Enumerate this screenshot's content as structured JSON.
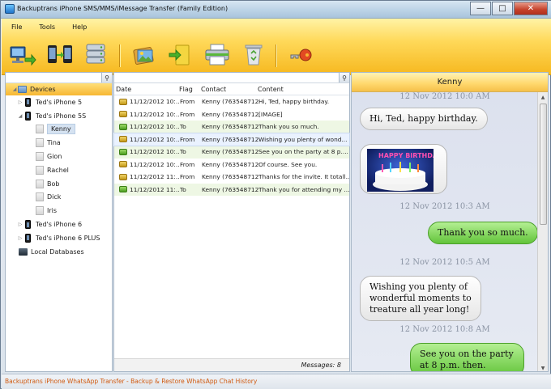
{
  "window": {
    "title": "Backuptrans iPhone SMS/MMS/iMessage Transfer (Family Edition)"
  },
  "menu": [
    "File",
    "Tools",
    "Help"
  ],
  "toolbar": [
    {
      "name": "transfer-to-computer",
      "icon": "computer-transfer-icon"
    },
    {
      "name": "transfer-phone-to-phone",
      "icon": "phone-to-phone-icon"
    },
    {
      "name": "database",
      "icon": "database-icon"
    },
    {
      "name": "export-messages",
      "icon": "export-icon"
    },
    {
      "name": "import-messages",
      "icon": "import-icon"
    },
    {
      "name": "print",
      "icon": "printer-icon"
    },
    {
      "name": "delete",
      "icon": "recycle-bin-icon"
    },
    {
      "name": "register",
      "icon": "key-icon"
    }
  ],
  "tree": {
    "header": "Devices",
    "items": [
      {
        "label": "Ted's iPhone 5",
        "level": 1,
        "type": "phone",
        "expandable": true
      },
      {
        "label": "Ted's iPhone 5S",
        "level": 1,
        "type": "phone",
        "expanded": true
      },
      {
        "label": "Kenny",
        "level": 2,
        "type": "contact",
        "selected": true
      },
      {
        "label": "Tina",
        "level": 2,
        "type": "contact"
      },
      {
        "label": "Gion",
        "level": 2,
        "type": "contact"
      },
      {
        "label": "Rachel",
        "level": 2,
        "type": "contact"
      },
      {
        "label": "Bob",
        "level": 2,
        "type": "contact"
      },
      {
        "label": "Dick",
        "level": 2,
        "type": "contact"
      },
      {
        "label": "Iris",
        "level": 2,
        "type": "contact"
      },
      {
        "label": "Ted's iPhone 6",
        "level": 1,
        "type": "phone",
        "expandable": true
      },
      {
        "label": "Ted's iPhone 6 PLUS",
        "level": 1,
        "type": "phone",
        "expandable": true
      },
      {
        "label": "Local Databases",
        "level": 0,
        "type": "db"
      }
    ]
  },
  "list": {
    "columns": [
      "Date",
      "Flag",
      "Contact",
      "Content"
    ],
    "rows": [
      {
        "date": "11/12/2012 10:...",
        "flag": "From",
        "contact": "Kenny (763548712)",
        "content": "Hi, Ted, happy birthday.",
        "dir": "in"
      },
      {
        "date": "11/12/2012 10:...",
        "flag": "From",
        "contact": "Kenny (763548712)",
        "content": "[IMAGE]",
        "dir": "in"
      },
      {
        "date": "11/12/2012 10:...",
        "flag": "To",
        "contact": "Kenny (763548712)",
        "content": "Thank you so much.",
        "dir": "out"
      },
      {
        "date": "11/12/2012 10:...",
        "flag": "From",
        "contact": "Kenny (763548712)",
        "content": "Wishing you plenty of wond...",
        "dir": "in"
      },
      {
        "date": "11/12/2012 10:...",
        "flag": "To",
        "contact": "Kenny (763548712)",
        "content": "See you on the party at 8 p....",
        "dir": "out"
      },
      {
        "date": "11/12/2012 10:...",
        "flag": "From",
        "contact": "Kenny (763548712)",
        "content": "Of course. See you.",
        "dir": "in"
      },
      {
        "date": "11/12/2012 11:...",
        "flag": "From",
        "contact": "Kenny (763548712)",
        "content": "Thanks for the invite. It totall...",
        "dir": "in"
      },
      {
        "date": "11/12/2012 11:...",
        "flag": "To",
        "contact": "Kenny (763548712)",
        "content": "Thank you for attending my ...",
        "dir": "out"
      }
    ],
    "footer": "Messages: 8"
  },
  "chat": {
    "title": "Kenny",
    "items": [
      {
        "kind": "ts",
        "text": "12 Nov 2012 10:0 AM"
      },
      {
        "kind": "msg",
        "dir": "in",
        "text": "Hi, Ted, happy birthday."
      },
      {
        "kind": "image",
        "dir": "in",
        "text": "HAPPY BIRTHDAY"
      },
      {
        "kind": "ts",
        "text": "12 Nov 2012 10:3 AM"
      },
      {
        "kind": "msg",
        "dir": "out",
        "text": "Thank you so much."
      },
      {
        "kind": "ts",
        "text": "12 Nov 2012 10:5 AM"
      },
      {
        "kind": "msg",
        "dir": "in",
        "text": "Wishing you plenty of wonderful moments to treature all year long!"
      },
      {
        "kind": "ts",
        "text": "12 Nov 2012 10:8 AM"
      },
      {
        "kind": "msg",
        "dir": "out",
        "text": "See you on the party at 8 p.m. then."
      }
    ]
  },
  "status": "Backuptrans iPhone WhatsApp Transfer - Backup & Restore WhatsApp Chat History",
  "colors": {
    "ribbon": "#f6b81f",
    "incoming": "#e6e6e6",
    "outgoing": "#62c43a",
    "status_link": "#d05a10"
  }
}
